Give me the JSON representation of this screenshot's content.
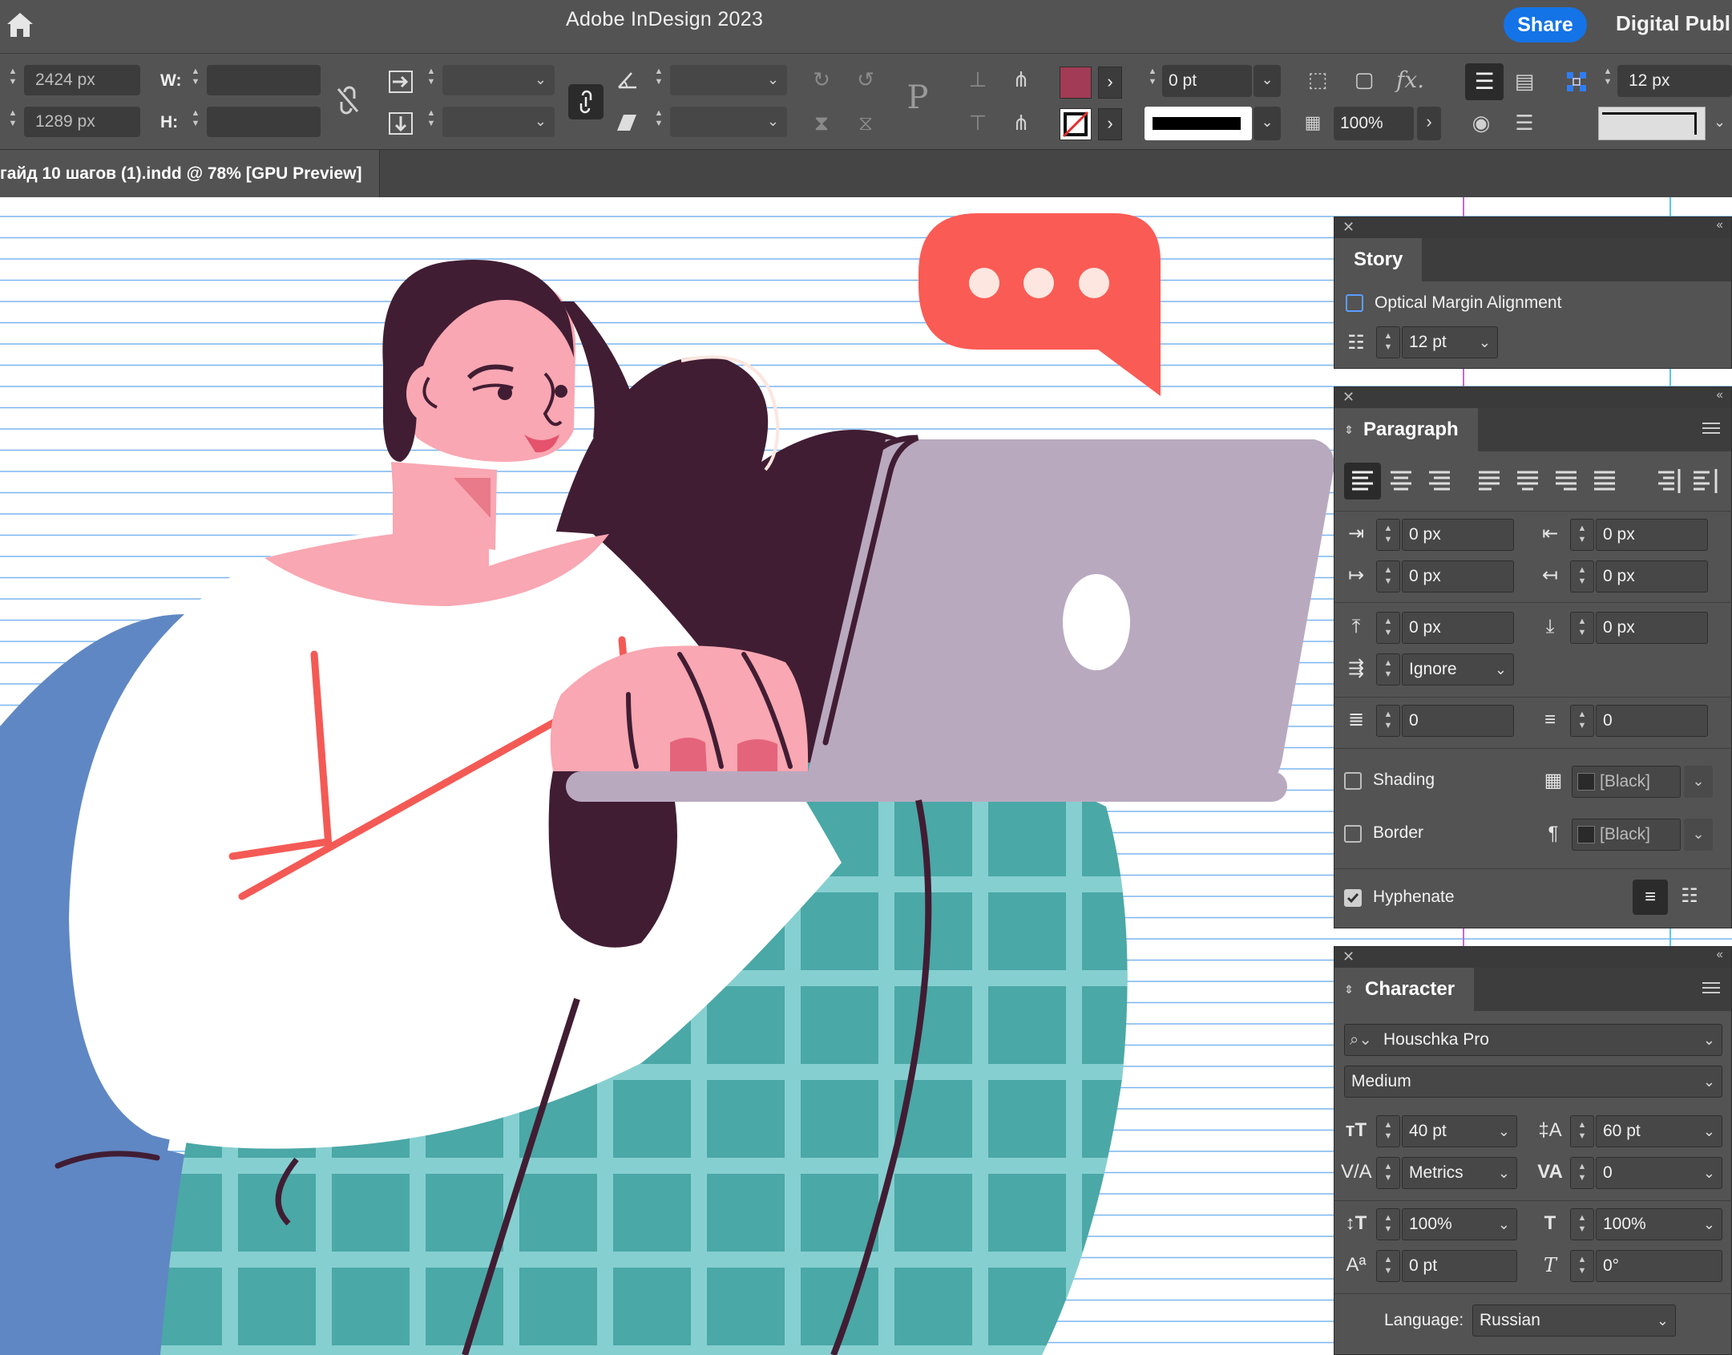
{
  "app": {
    "title": "Adobe InDesign 2023",
    "share_label": "Share",
    "workspace": "Digital Publ",
    "home_icon": "home-icon"
  },
  "document": {
    "tab_label": "гайд 10 шагов (1).indd @ 78% [GPU Preview]"
  },
  "control_bar": {
    "x_value": "2424 px",
    "y_value": "1289 px",
    "w_label": "W:",
    "h_label": "H:",
    "stroke_weight": "0 pt",
    "opacity": "100%",
    "gap_value": "12 px",
    "fill_color": "#a23b55"
  },
  "story_panel": {
    "tab": "Story",
    "optical_margin_label": "Optical Margin Alignment",
    "optical_margin_checked": false,
    "size_value": "12 pt"
  },
  "paragraph_panel": {
    "tab": "Paragraph",
    "left_indent": "0 px",
    "right_indent": "0 px",
    "first_line_indent": "0 px",
    "last_line_indent": "0 px",
    "space_before": "0 px",
    "space_after": "0 px",
    "align_to_grid": "Ignore",
    "drop_cap_lines": "0",
    "drop_cap_chars": "0",
    "shading_label": "Shading",
    "shading_checked": false,
    "shading_color": "[Black]",
    "border_label": "Border",
    "border_checked": false,
    "border_color": "[Black]",
    "hyphenate_label": "Hyphenate",
    "hyphenate_checked": true
  },
  "character_panel": {
    "tab": "Character",
    "font_family": "Houschka Pro",
    "font_style": "Medium",
    "font_size": "40 pt",
    "leading": "60 pt",
    "kerning": "Metrics",
    "tracking": "0",
    "vertical_scale": "100%",
    "horizontal_scale": "100%",
    "baseline_shift": "0 pt",
    "skew": "0°",
    "language_label": "Language:",
    "language": "Russian"
  }
}
